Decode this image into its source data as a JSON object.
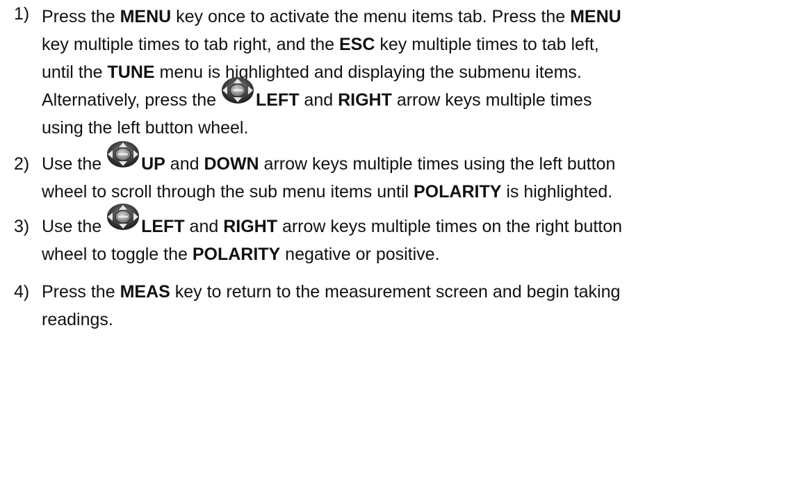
{
  "steps": [
    {
      "number": "1)",
      "l1": {
        "a": "Press the ",
        "b": "MENU",
        "c": " key once to activate the menu items tab.  Press the ",
        "d": "MENU"
      },
      "l2": {
        "a": "key multiple times to tab right, and the ",
        "b": "ESC",
        "c": " key multiple times to tab left,"
      },
      "l3": {
        "a": "until the ",
        "b": "TUNE",
        "c": " menu is highlighted and displaying the submenu items."
      },
      "l4": {
        "a": "Alternatively, press the ",
        "icon": "enter-wheel-icon",
        "b": "LEFT",
        "c": " and ",
        "d": "RIGHT",
        "e": " arrow keys multiple times"
      },
      "l5": {
        "a": "using the left button wheel."
      }
    },
    {
      "number": "2)",
      "l1": {
        "a": "Use the ",
        "icon": "enter-wheel-icon",
        "b": "UP",
        "c": " and ",
        "d": "DOWN",
        "e": " arrow keys multiple times using the left button"
      },
      "l2": {
        "a": "wheel to scroll through the sub menu items until ",
        "b": "POLARITY",
        "c": " is highlighted."
      }
    },
    {
      "number": "3)",
      "l1": {
        "a": "Use the ",
        "icon": "gain-wheel-icon",
        "b": "LEFT",
        "c": " and ",
        "d": "RIGHT",
        "e": " arrow keys multiple times on the right button"
      },
      "l2": {
        "a": "wheel to toggle the ",
        "b": "POLARITY",
        "c": " negative or positive."
      }
    },
    {
      "number": "4)",
      "l1": {
        "a": "Press the ",
        "b": "MEAS",
        "c": " key to return to the measurement screen and begin taking"
      },
      "l2": {
        "a": "readings."
      }
    }
  ]
}
